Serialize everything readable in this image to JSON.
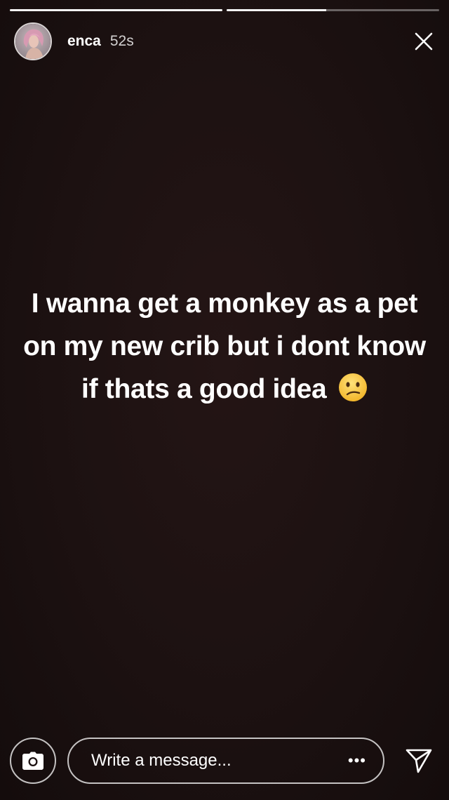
{
  "story": {
    "progress": [
      1.0,
      0.47
    ],
    "user": {
      "username": "enca",
      "timestamp": "52s"
    },
    "text": "I wanna get a monkey as a pet on my new crib but i dont know if thats a good idea",
    "emoji": "confused-face-emoji"
  },
  "header": {
    "close_icon": "close-icon"
  },
  "footer": {
    "camera_icon": "camera-icon",
    "message_placeholder": "Write a message...",
    "more_label": "•••",
    "send_icon": "send-icon"
  },
  "colors": {
    "background": "#1c1111",
    "text": "#ffffff",
    "emoji": "#f7c23a"
  }
}
